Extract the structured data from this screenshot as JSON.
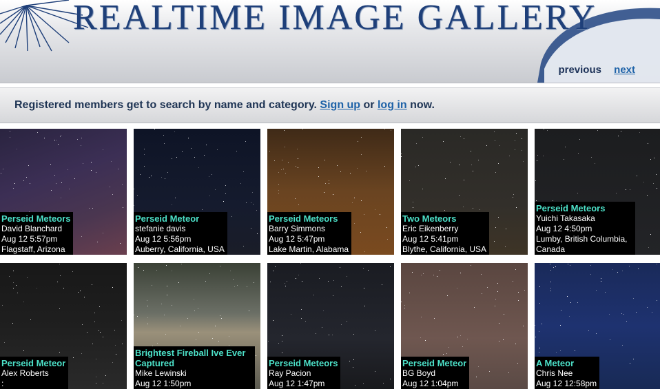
{
  "header": {
    "title": "REALTIME IMAGE GALLERY",
    "nav_previous": "previous",
    "nav_next": "next"
  },
  "notice": {
    "text_before": "Registered members get to search by name and category. ",
    "signup_label": "Sign up",
    "text_middle": " or ",
    "login_label": "log in",
    "text_after": " now."
  },
  "colors": {
    "title_blue": "#1e3f79",
    "link_blue": "#1f63a8",
    "caption_title": "#4ce0c8",
    "caption_bg": "#000000"
  },
  "gallery": [
    {
      "title": "Perseid Meteors",
      "author": "David Blanchard",
      "datetime": "Aug 12 5:57pm",
      "location": "Flagstaff, Arizona",
      "bg": "linear-gradient(160deg,#2a2440 0%,#3c2f55 40%,#4a3650 70%,#6a3f4e 100%)"
    },
    {
      "title": "Perseid Meteor",
      "author": "stefanie davis",
      "datetime": "Aug 12 5:56pm",
      "location": "Auberry, California, USA",
      "bg": "linear-gradient(180deg,#0e1426 0%,#151b2e 60%,#1a1d28 100%)"
    },
    {
      "title": "Perseid Meteors",
      "author": "Barry Simmons",
      "datetime": "Aug 12 5:47pm",
      "location": "Lake Martin, Alabama",
      "bg": "linear-gradient(180deg,#3f2a17 0%,#6a4421 50%,#7a4a1f 100%)"
    },
    {
      "title": "Two Meteors",
      "author": "Eric Eikenberry",
      "datetime": "Aug 12 5:41pm",
      "location": "Blythe, California, USA",
      "bg": "linear-gradient(180deg,#2a2926 0%,#322f2a 60%,#3e3426 100%)"
    },
    {
      "title": "Perseid Meteors",
      "author": "Yuichi Takasaka",
      "datetime": "Aug 12 4:50pm",
      "location": "Lumby, British Columbia, Canada",
      "bg": "linear-gradient(180deg,#1c1d1f 0%,#232427 100%)"
    },
    {
      "title": "Perseid Meteor",
      "author": "Alex Roberts",
      "datetime": ":",
      "location": "",
      "bg": "linear-gradient(180deg,#181818 0%,#1f1f1f 50%,#2a2a2a 100%)"
    },
    {
      "title": "Brightest Fireball Ive Ever Captured",
      "author": "Mike Lewinski",
      "datetime": "Aug 12 1:50pm",
      "location": "",
      "bg": "linear-gradient(180deg,#3b4136 0%,#6b6f66 40%,#9a907a 55%,#5b5a50 100%)"
    },
    {
      "title": "Perseid Meteors",
      "author": "Ray Pacion",
      "datetime": "Aug 12 1:47pm",
      "location": "",
      "bg": "linear-gradient(180deg,#1a1c22 0%,#24262e 60%,#18191c 100%)"
    },
    {
      "title": "Perseid Meteor",
      "author": "BG Boyd",
      "datetime": "Aug 12 1:04pm",
      "location": "",
      "bg": "linear-gradient(180deg,#5a4640 0%,#6f5750 60%,#5a4a45 100%)"
    },
    {
      "title": "A Meteor",
      "author": "Chris Nee",
      "datetime": "Aug 12 12:58pm",
      "location": "",
      "bg": "linear-gradient(180deg,#1a2a5a 0%,#1e3270 50%,#182a55 100%)"
    }
  ]
}
